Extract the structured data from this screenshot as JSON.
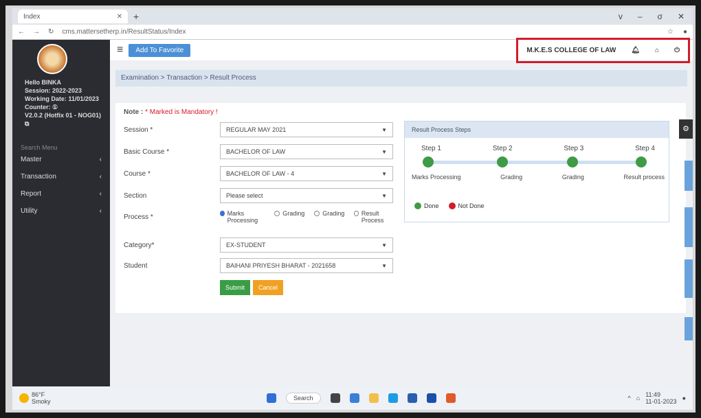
{
  "browser": {
    "tab_title": "Index",
    "url": "cms.mattersetherp.in/ResultStatus/Index",
    "window_controls": [
      "v",
      "–",
      "σ",
      "✕"
    ]
  },
  "sidebar": {
    "greeting": "Hello BINKA",
    "session": "Session: 2022-2023",
    "working_date": "Working Date: 11/01/2023",
    "counter": "Counter: ①",
    "version": "V2.0.2 (Hotfix 01 - NOG01)",
    "section_label": "Search Menu",
    "items": [
      {
        "label": "Master",
        "chevron": "‹"
      },
      {
        "label": "Transaction",
        "chevron": "‹"
      },
      {
        "label": "Report",
        "chevron": "‹"
      },
      {
        "label": "Utility",
        "chevron": "‹"
      }
    ]
  },
  "topbar": {
    "add_button": "Add To Favorite",
    "college": "M.K.E.S COLLEGE OF LAW",
    "icons": [
      "bell-icon",
      "home-icon",
      "power-icon"
    ]
  },
  "breadcrumb": "Examination > Transaction > Result Process",
  "note": {
    "prefix": "Note : ",
    "text": "* Marked is Mandatory !"
  },
  "form": {
    "session_label": "Session *",
    "session_value": "REGULAR MAY 2021",
    "basic_course_label": "Basic Course *",
    "basic_course_value": "BACHELOR OF LAW",
    "course_label": "Course *",
    "course_value": "BACHELOR OF LAW - 4",
    "section_label": "Section",
    "section_value": "Please select",
    "process_label": "Process *",
    "process_options": [
      "Marks Processing",
      "Grading",
      "Grading",
      "Result Process"
    ],
    "category_label": "Category*",
    "category_value": "EX-STUDENT",
    "student_label": "Student",
    "student_value": "BAIHANI PRIYESH BHARAT - 2021658",
    "submit": "Submit",
    "cancel": "Cancel"
  },
  "steps": {
    "title": "Result Process Steps",
    "steps": [
      "Step 1",
      "Step 2",
      "Step 3",
      "Step 4"
    ],
    "names": [
      "Marks Processing",
      "Grading",
      "Grading",
      "Result process"
    ],
    "legend_done": "Done",
    "legend_not_done": "Not Done",
    "colors": {
      "done": "#3f9b45",
      "not_done": "#d21b2b"
    }
  },
  "taskbar": {
    "weather_temp": "86°F",
    "weather_desc": "Smoky",
    "search": "Search",
    "time": "11:49",
    "date": "11-01-2023"
  }
}
